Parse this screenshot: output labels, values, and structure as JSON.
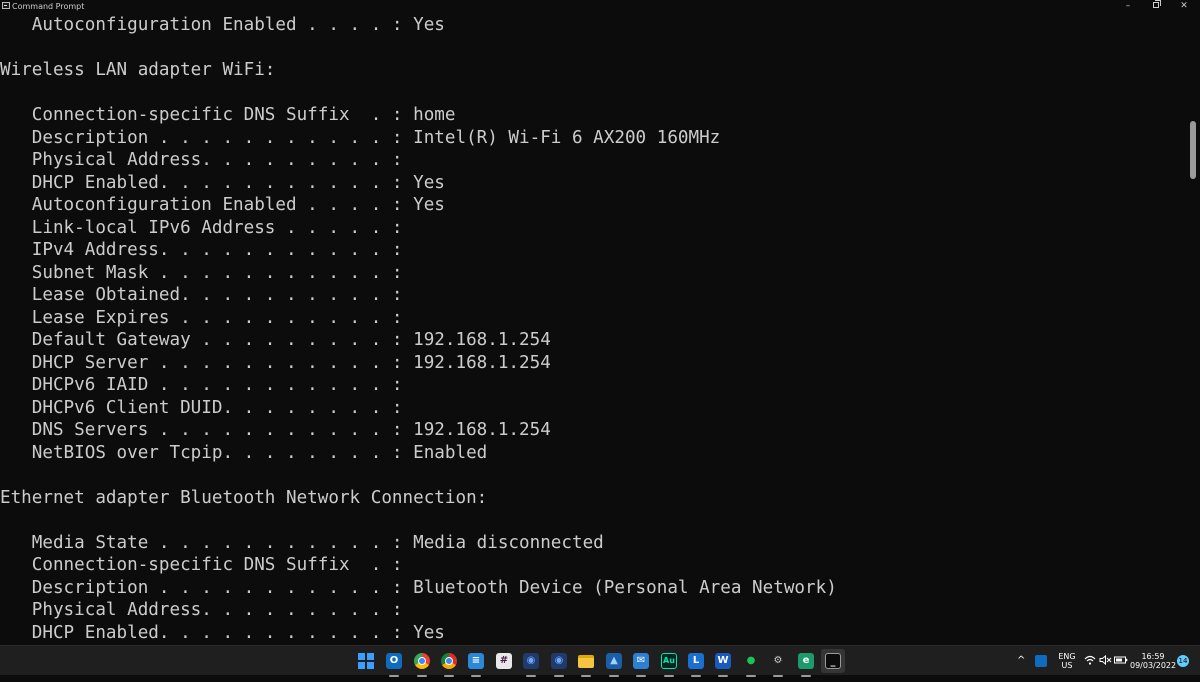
{
  "window": {
    "title": "Command Prompt",
    "minimize_glyph": "–",
    "close_glyph": "✕"
  },
  "console": {
    "lines": [
      "   Autoconfiguration Enabled . . . . : Yes",
      "",
      "Wireless LAN adapter WiFi:",
      "",
      "   Connection-specific DNS Suffix  . : home",
      "   Description . . . . . . . . . . . : Intel(R) Wi-Fi 6 AX200 160MHz",
      "   Physical Address. . . . . . . . . :",
      "   DHCP Enabled. . . . . . . . . . . : Yes",
      "   Autoconfiguration Enabled . . . . : Yes",
      "   Link-local IPv6 Address . . . . . :",
      "   IPv4 Address. . . . . . . . . . . :",
      "   Subnet Mask . . . . . . . . . . . :",
      "   Lease Obtained. . . . . . . . . . :",
      "   Lease Expires . . . . . . . . . . :",
      "   Default Gateway . . . . . . . . . : 192.168.1.254",
      "   DHCP Server . . . . . . . . . . . : 192.168.1.254",
      "   DHCPv6 IAID . . . . . . . . . . . :",
      "   DHCPv6 Client DUID. . . . . . . . :",
      "   DNS Servers . . . . . . . . . . . : 192.168.1.254",
      "   NetBIOS over Tcpip. . . . . . . . : Enabled",
      "",
      "Ethernet adapter Bluetooth Network Connection:",
      "",
      "   Media State . . . . . . . . . . . : Media disconnected",
      "   Connection-specific DNS Suffix  . :",
      "   Description . . . . . . . . . . . : Bluetooth Device (Personal Area Network)",
      "   Physical Address. . . . . . . . . :",
      "   DHCP Enabled. . . . . . . . . . . : Yes"
    ]
  },
  "taskbar": {
    "pinned": [
      {
        "name": "start-icon",
        "type": "start"
      },
      {
        "name": "outlook-icon",
        "label": "O",
        "bg": "#0f6cbd",
        "active": true
      },
      {
        "name": "chrome-icon",
        "type": "chrome",
        "active": true
      },
      {
        "name": "chrome-canary-icon",
        "type": "chrome2",
        "active": true
      },
      {
        "name": "notepad-icon",
        "label": "≡",
        "bg": "#2b88d8",
        "active": true
      },
      {
        "name": "slack-icon",
        "label": "#",
        "bg": "#e8e8e8",
        "fg": "#4a154b"
      },
      {
        "name": "app-icon-blue-1",
        "label": "◉",
        "bg": "#1f3a6b",
        "fg": "#6fa8ff",
        "active": true
      },
      {
        "name": "app-icon-blue-2",
        "label": "◉",
        "bg": "#1f3a6b",
        "fg": "#6fa8ff",
        "active": true
      },
      {
        "name": "file-explorer-icon",
        "type": "folder",
        "active": true
      },
      {
        "name": "photos-icon",
        "label": "▲",
        "bg": "#1b5fa8",
        "fg": "#9fd0ff",
        "active": true
      },
      {
        "name": "mail-icon",
        "label": "✉",
        "bg": "#2c7fd1",
        "active": true
      },
      {
        "name": "audition-icon",
        "label": "Au",
        "bg": "#00261b",
        "fg": "#00e4bb",
        "border": "#00e4bb",
        "active": true
      },
      {
        "name": "lync-icon",
        "label": "L",
        "bg": "#1a6fd1",
        "active": true
      },
      {
        "name": "word-icon",
        "label": "W",
        "bg": "#185abd",
        "active": true
      },
      {
        "name": "wechat-icon",
        "label": "●",
        "bg": "#1f1f1f",
        "fg": "#19c35a",
        "active": true
      },
      {
        "name": "settings-icon",
        "label": "⚙",
        "bg": "#1f1f1f",
        "fg": "#c8c8c8",
        "active": true
      },
      {
        "name": "edge-icon",
        "label": "e",
        "bg": "#1c9a6c",
        "active": true
      },
      {
        "name": "command-prompt-icon",
        "label": "_",
        "bg": "#0c0c0c",
        "border": "#9a9a9a",
        "current": true
      }
    ],
    "tray": {
      "chevron": "^",
      "lang_top": "ENG",
      "lang_bottom": "US",
      "time": "16:59",
      "date": "09/03/2022",
      "notifications": "14"
    }
  }
}
